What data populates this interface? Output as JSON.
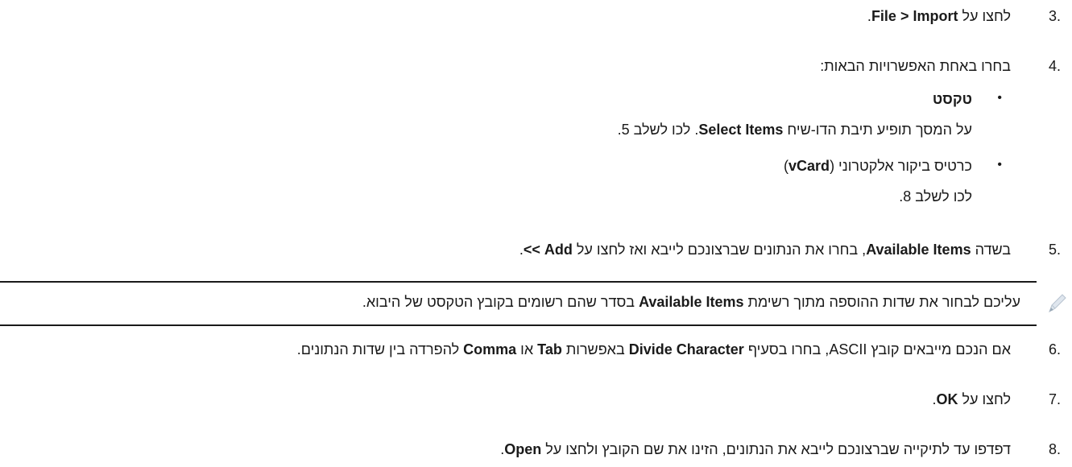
{
  "steps": [
    {
      "number": "3.",
      "text_a": "לחצו על ",
      "b1": "File > Import",
      "text_b": "."
    },
    {
      "number": "4.",
      "text": "בחרו באחת האפשרויות הבאות:"
    },
    {
      "number": "5.",
      "text_a": "בשדה ",
      "b1": "Available Items",
      "text_b": ", בחרו את הנתונים שברצונכם לייבא ואז לחצו על ",
      "b2": "Add >>",
      "text_c": "."
    },
    {
      "number": "6.",
      "text_a": "אם הנכם מייבאים קובץ ASCII, בחרו בסעיף ",
      "b1": "Divide Character",
      "text_b": " באפשרות ",
      "b2": "Tab",
      "text_c": " או ",
      "b3": "Comma",
      "text_d": " להפרדה בין שדות הנתונים."
    },
    {
      "number": "7.",
      "text_a": "לחצו על ",
      "b1": "OK",
      "text_b": "."
    },
    {
      "number": "8.",
      "text_a": "דפדפו עד לתיקייה שברצונכם לייבא את הנתונים, הזינו את שם הקובץ ולחצו על ",
      "b1": "Open",
      "text_b": "."
    }
  ],
  "options": [
    {
      "bullet": "•",
      "title": "טקסט",
      "desc_a": "על המסך תופיע תיבת הדו-שיח ",
      "desc_b": "Select Items",
      "desc_c": ". לכו לשלב 5."
    },
    {
      "bullet": "•",
      "title_a": "כרטיס ביקור אלקטרוני (",
      "title_b": "vCard",
      "title_c": ")",
      "desc": "לכו לשלב 8."
    }
  ],
  "note": {
    "icon": "pencil-note-icon",
    "text_a": "עליכם לבחור את שדות ההוספה מתוך רשימת ",
    "b1": "Available Items",
    "text_b": " בסדר שהם רשומים בקובץ הטקסט של היבוא."
  }
}
